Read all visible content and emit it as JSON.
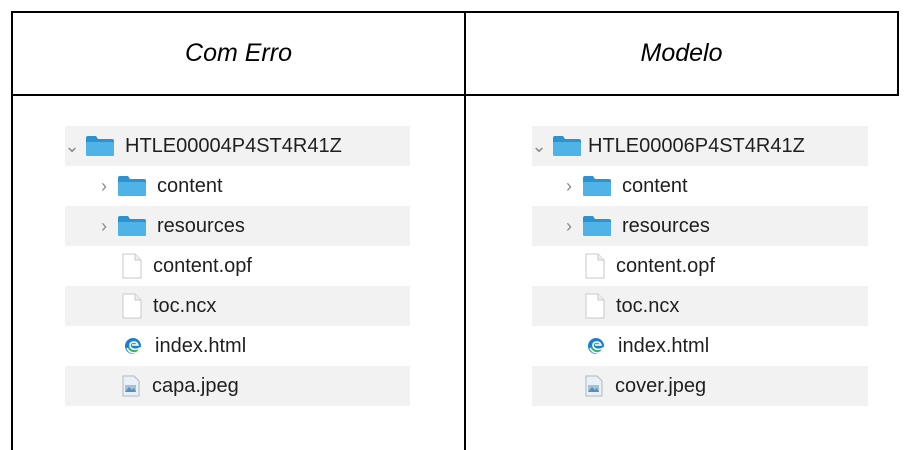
{
  "headers": {
    "left": "Com Erro",
    "right": "Modelo"
  },
  "left_tree": {
    "root": "HTLE00004P4ST4R41Z",
    "items": [
      {
        "label": "content",
        "type": "folder"
      },
      {
        "label": "resources",
        "type": "folder"
      },
      {
        "label": "content.opf",
        "type": "file"
      },
      {
        "label": "toc.ncx",
        "type": "file"
      },
      {
        "label": "index.html",
        "type": "html"
      },
      {
        "label": "capa.jpeg",
        "type": "image"
      }
    ]
  },
  "right_tree": {
    "root": "HTLE00006P4ST4R41Z",
    "items": [
      {
        "label": "content",
        "type": "folder"
      },
      {
        "label": "resources",
        "type": "folder"
      },
      {
        "label": "content.opf",
        "type": "file"
      },
      {
        "label": "toc.ncx",
        "type": "file"
      },
      {
        "label": "index.html",
        "type": "html"
      },
      {
        "label": "cover.jpeg",
        "type": "image"
      }
    ]
  },
  "colors": {
    "folder": "#4fb3e8",
    "folder_dark": "#2c93cf",
    "row_alt": "#f2f2f2",
    "edge_blue": "#1a7fd4",
    "edge_green": "#38b56a"
  }
}
